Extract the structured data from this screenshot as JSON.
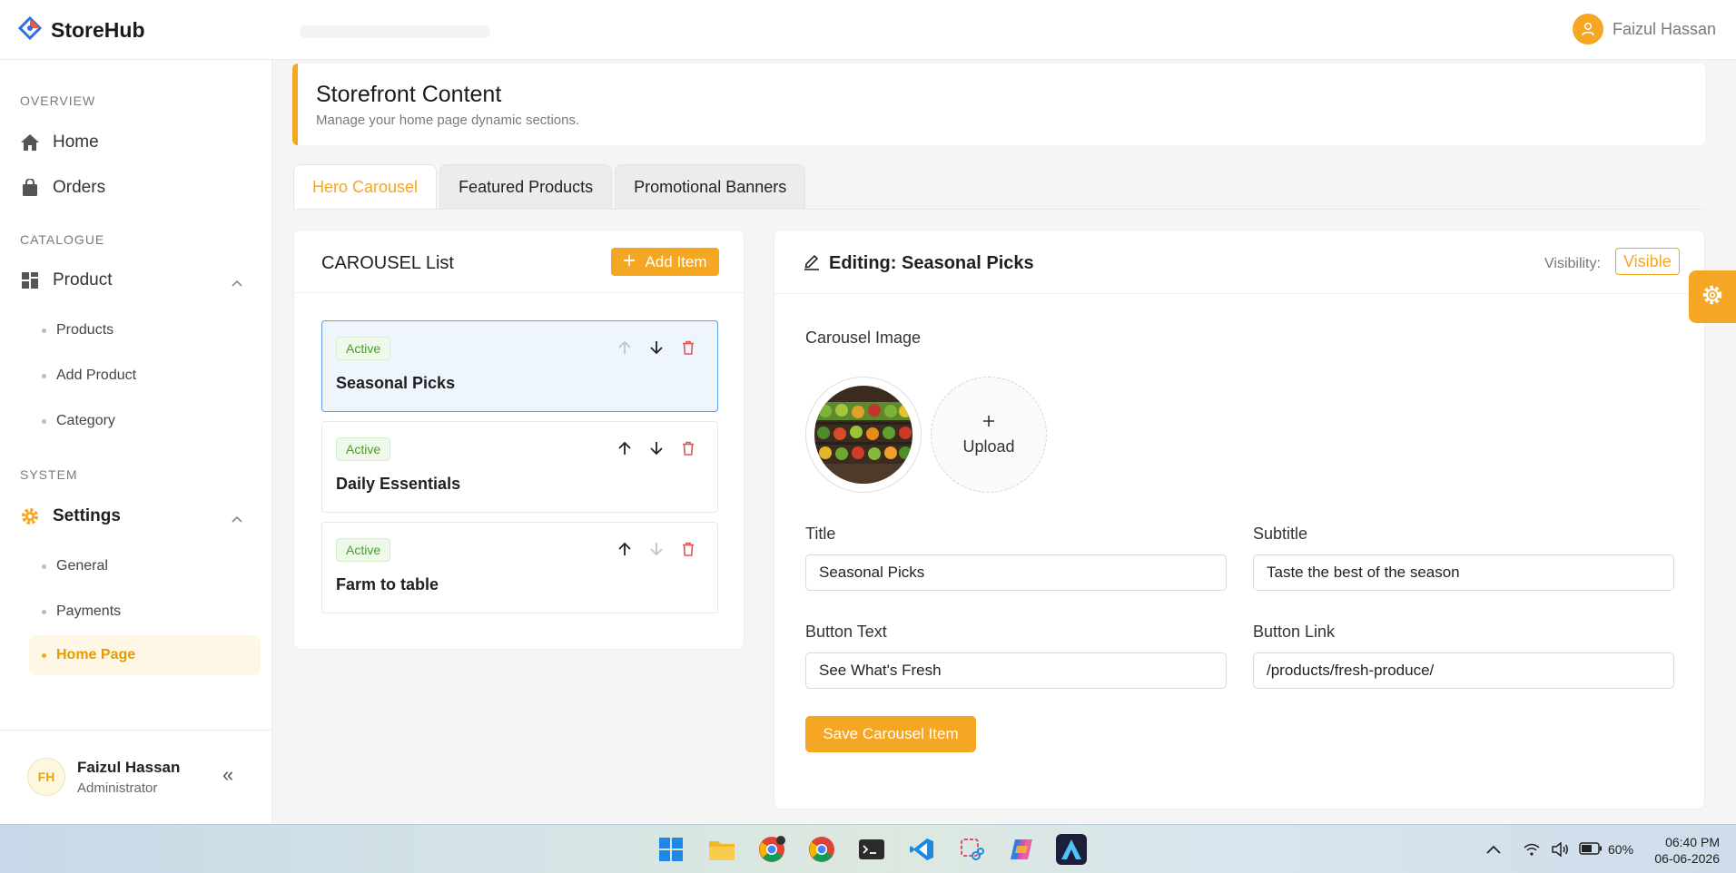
{
  "app": {
    "brand": "StoreHub",
    "user_name": "Faizul Hassan"
  },
  "sidebar": {
    "sections": {
      "overview": "OVERVIEW",
      "catalogue": "CATALOGUE",
      "system": "SYSTEM"
    },
    "items": {
      "home": "Home",
      "orders": "Orders",
      "product": "Product",
      "settings": "Settings"
    },
    "product_sub": [
      "Products",
      "Add Product",
      "Category"
    ],
    "settings_sub": [
      "General",
      "Payments",
      "Home Page"
    ],
    "footer": {
      "initials": "FH",
      "name": "Faizul Hassan",
      "role": "Administrator",
      "collapse": "«"
    }
  },
  "page": {
    "title": "Storefront Content",
    "subtitle": "Manage your home page dynamic sections."
  },
  "tabs": [
    "Hero Carousel",
    "Featured Products",
    "Promotional Banners"
  ],
  "list": {
    "title": "CAROUSEL List",
    "add_label": "Add Item",
    "items": [
      {
        "status": "Active",
        "title": "Seasonal Picks"
      },
      {
        "status": "Active",
        "title": "Daily Essentials"
      },
      {
        "status": "Active",
        "title": "Farm to table"
      }
    ]
  },
  "editor": {
    "heading": "Editing: Seasonal Picks",
    "visibility_label": "Visibility:",
    "visibility_value": "Visible",
    "image_label": "Carousel Image",
    "upload_label": "Upload",
    "fields": {
      "title_label": "Title",
      "title_value": "Seasonal Picks",
      "subtitle_label": "Subtitle",
      "subtitle_value": "Taste the best of the season",
      "button_text_label": "Button Text",
      "button_text_value": "See What's Fresh",
      "button_link_label": "Button Link",
      "button_link_value": "/products/fresh-produce/"
    },
    "save_label": "Save Carousel Item"
  },
  "taskbar": {
    "battery": "60%",
    "time": "06:40 PM",
    "date": "06-06-2026"
  },
  "colors": {
    "accent": "#f5a623",
    "active_badge": "#4b9c2a",
    "delete": "#e05353",
    "selected_border": "#5b9fe3"
  }
}
